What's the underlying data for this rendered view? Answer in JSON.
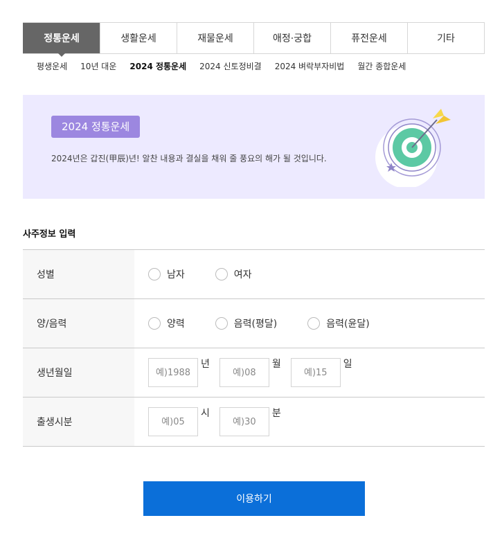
{
  "tabs": [
    {
      "label": "정통운세",
      "active": true
    },
    {
      "label": "생활운세",
      "active": false
    },
    {
      "label": "재물운세",
      "active": false
    },
    {
      "label": "애정·궁합",
      "active": false
    },
    {
      "label": "퓨전운세",
      "active": false
    },
    {
      "label": "기타",
      "active": false
    }
  ],
  "subnav": [
    {
      "label": "평생운세",
      "active": false
    },
    {
      "label": "10년 대운",
      "active": false
    },
    {
      "label": "2024 정통운세",
      "active": true
    },
    {
      "label": "2024 신토정비결",
      "active": false
    },
    {
      "label": "2024 벼락부자비법",
      "active": false
    },
    {
      "label": "월간 종합운세",
      "active": false
    }
  ],
  "banner": {
    "badge": "2024 정통운세",
    "description": "2024년은 갑진(甲辰)년! 알찬 내용과 결실을 채워 줄 풍요의 해가 될 것입니다.",
    "icon": "target-dart-icon",
    "background_color": "#edeaff",
    "badge_color": "#9c87e0"
  },
  "form": {
    "title": "사주정보 입력",
    "gender": {
      "label": "성별",
      "options": [
        "남자",
        "여자"
      ]
    },
    "calendar": {
      "label": "양/음력",
      "options": [
        "양력",
        "음력(평달)",
        "음력(윤달)"
      ]
    },
    "birthdate": {
      "label": "생년월일",
      "year_placeholder": "예)1988",
      "year_unit": "년",
      "month_placeholder": "예)08",
      "month_unit": "월",
      "day_placeholder": "예)15",
      "day_unit": "일"
    },
    "birthtime": {
      "label": "출생시분",
      "hour_placeholder": "예)05",
      "hour_unit": "시",
      "minute_placeholder": "예)30",
      "minute_unit": "분"
    }
  },
  "submit": {
    "label": "이용하기",
    "color": "#0b6fd9"
  }
}
